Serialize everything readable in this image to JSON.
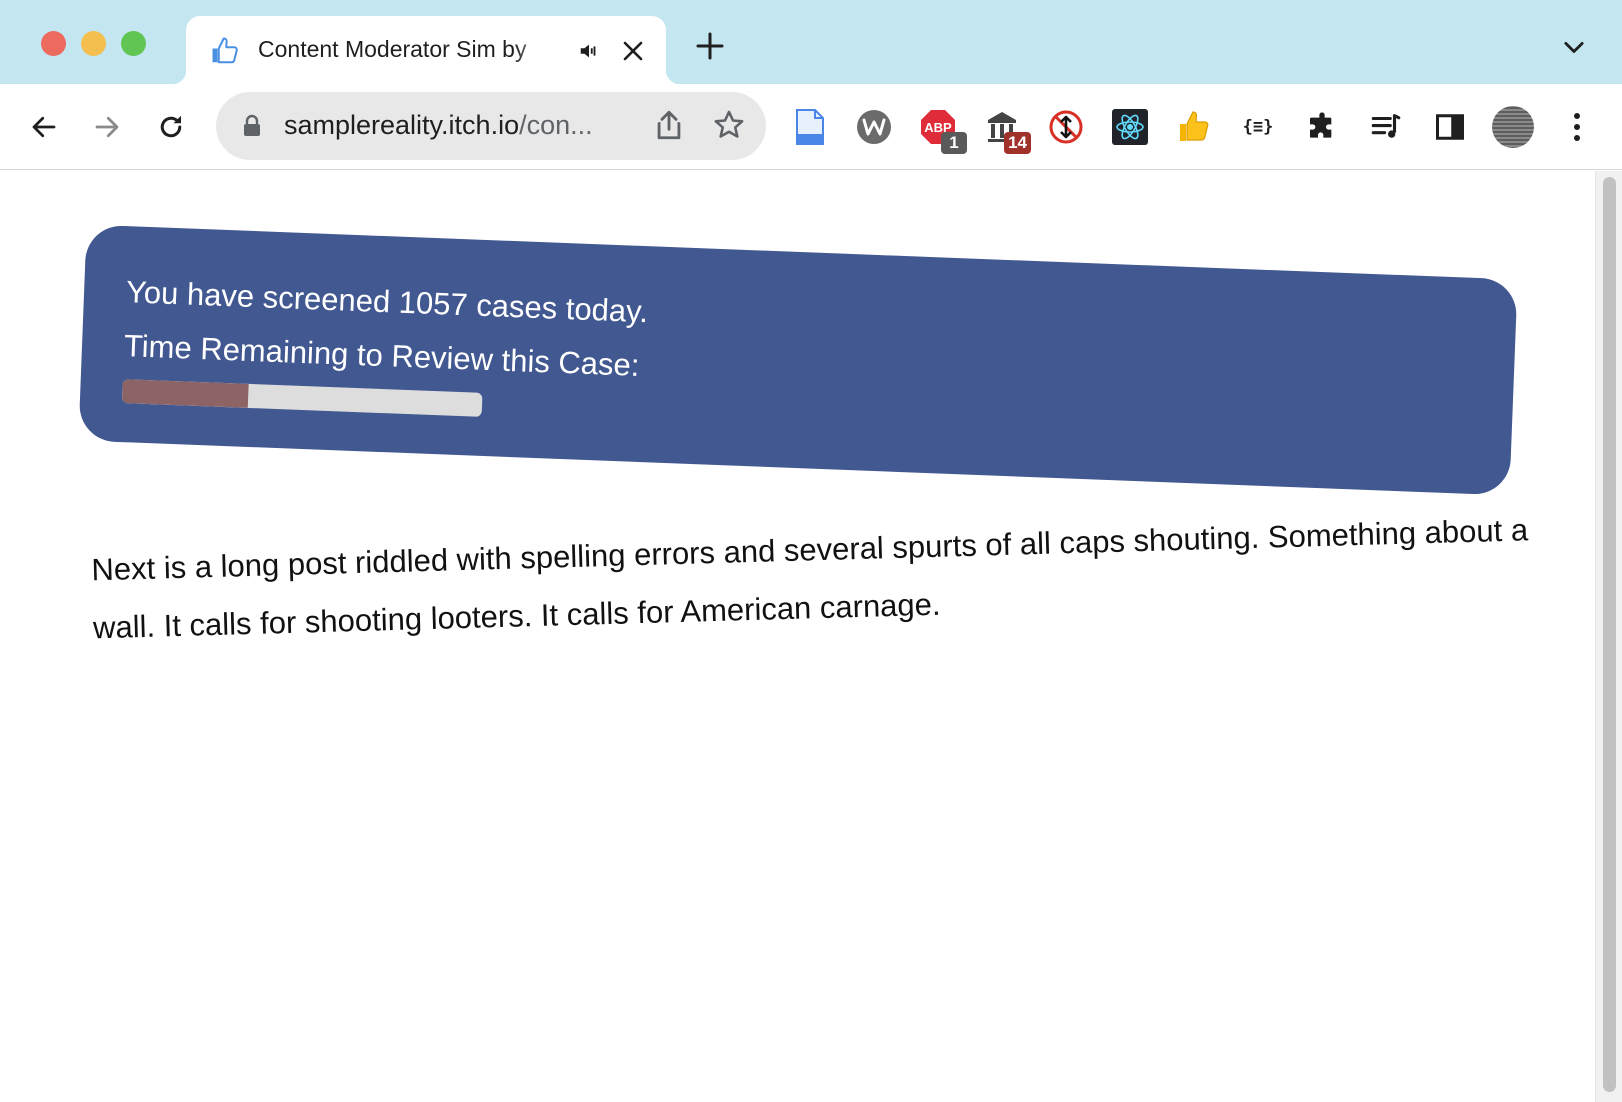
{
  "tab": {
    "title": "Content Moderator Sim by",
    "favicon": "thumbs-up-icon"
  },
  "omnibox": {
    "host": "samplereality.itch.io",
    "path": "/con..."
  },
  "extensions": [
    {
      "name": "document-icon"
    },
    {
      "name": "wappalyzer-icon"
    },
    {
      "name": "adblock-plus-icon",
      "badge": "1",
      "badge_color": "#5a5a5a"
    },
    {
      "name": "museum-icon",
      "badge": "14",
      "badge_color": "#a0322b"
    },
    {
      "name": "no-scroll-icon"
    },
    {
      "name": "react-devtools-icon"
    },
    {
      "name": "thumbs-up-icon"
    },
    {
      "name": "json-viewer-icon",
      "label": "{≡}"
    },
    {
      "name": "extensions-puzzle-icon"
    },
    {
      "name": "media-playlist-icon"
    },
    {
      "name": "side-panel-icon"
    },
    {
      "name": "profile-avatar"
    },
    {
      "name": "more-menu-icon"
    }
  ],
  "game": {
    "screened_text": "You have screened 1057 cases today.",
    "timer_label": "Time Remaining to Review this Case:",
    "time_remaining_fraction": 0.35,
    "progress_fill_color": "#8c6466",
    "card_color": "#425891",
    "post_text": "Next is a long post riddled with spelling errors and several spurts of all caps shouting. Something about a wall. It calls for shooting looters. It calls for American carnage."
  },
  "colors": {
    "tabstrip": "#c3e6f1",
    "card": "#425891"
  }
}
